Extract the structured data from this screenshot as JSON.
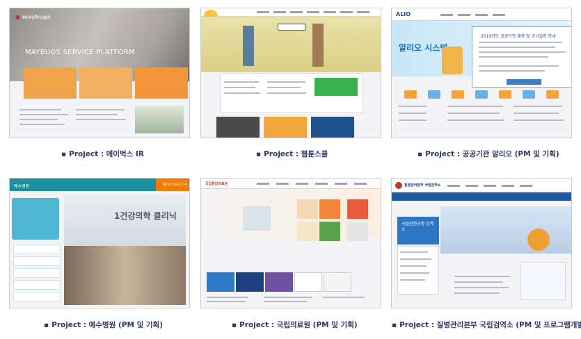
{
  "projects": [
    {
      "caption": "Project : 메이벅스 IR",
      "site_logo": "maybugs",
      "site_headline": "MAYBUGS SERVICE PLATFORM",
      "accent": "#f0a34a"
    },
    {
      "caption": "Project : 웹툰스쿨",
      "accent": "#38b24a"
    },
    {
      "caption": "Project : 공공기관 알리오 (PM 및 기획)",
      "site_logo": "ALIO",
      "site_headline": "알리오 시스템",
      "popup_title": "2019년도 공공기관 채용 및 공시일정 안내",
      "accent": "#0d75c3"
    },
    {
      "caption": "Project :  예수병원 (PM 및 기획)",
      "site_logo": "예수병원",
      "phone": "063-230-8114",
      "site_headline": "1건강의학 클리닉",
      "accent": "#1a8fa0"
    },
    {
      "caption": "Project : 국립의료원 (PM 및 기획)",
      "site_logo": "국립중앙의료원",
      "accent": "#2f79c4"
    },
    {
      "caption": "Project : 질병관리본부 국립검역소 (PM 및 프로그램개발)",
      "site_logo": "질병관리본부 국립검역소",
      "site_headline": "국립인천공항 검역소",
      "accent": "#1c5aa6"
    }
  ]
}
